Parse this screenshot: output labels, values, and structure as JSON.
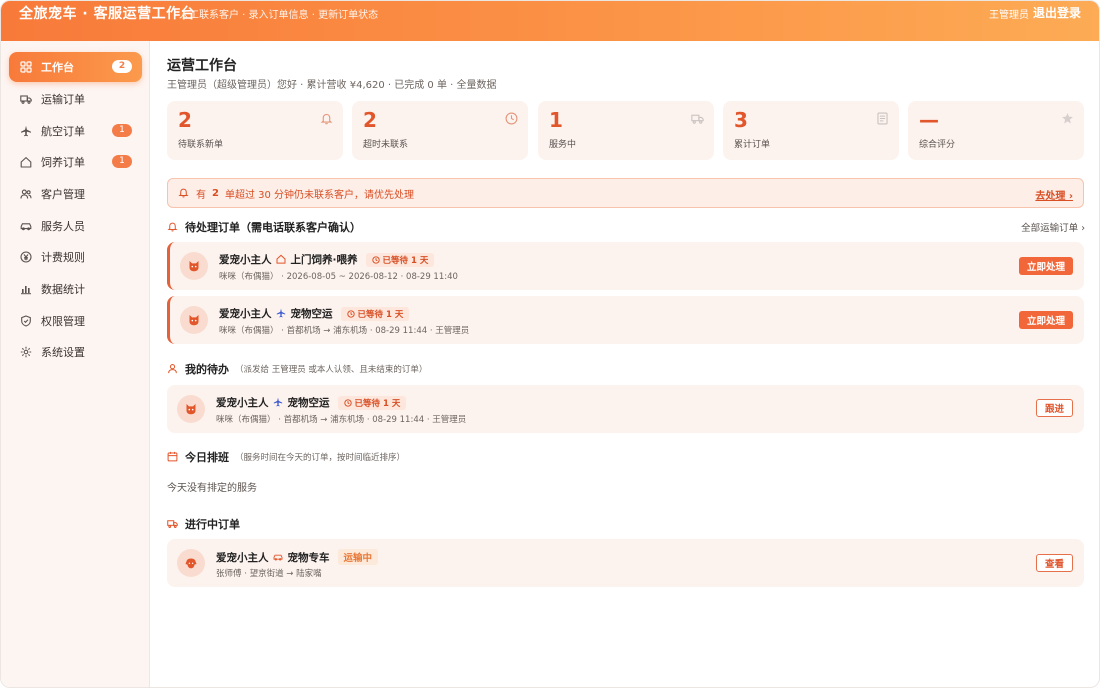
{
  "header": {
    "brand": "全旅宠车 · 客服运营工作台",
    "subtitle": "人工联系客户 · 录入订单信息 · 更新订单状态",
    "user": "王管理员",
    "logout": "退出登录"
  },
  "sidebar": {
    "items": [
      {
        "label": "工作台",
        "icon": "grid-icon",
        "badge": "2"
      },
      {
        "label": "运输订单",
        "icon": "truck-icon",
        "badge": ""
      },
      {
        "label": "航空订单",
        "icon": "plane-icon",
        "badge": "1"
      },
      {
        "label": "饲养订单",
        "icon": "home-icon",
        "badge": "1"
      },
      {
        "label": "客户管理",
        "icon": "users-icon",
        "badge": ""
      },
      {
        "label": "服务人员",
        "icon": "car-icon",
        "badge": ""
      },
      {
        "label": "计费规则",
        "icon": "yen-icon",
        "badge": ""
      },
      {
        "label": "数据统计",
        "icon": "bar-chart-icon",
        "badge": ""
      },
      {
        "label": "权限管理",
        "icon": "shield-icon",
        "badge": ""
      },
      {
        "label": "系统设置",
        "icon": "gear-icon",
        "badge": ""
      }
    ]
  },
  "main": {
    "title": "运营工作台",
    "subtitle": "王管理员（超级管理员）您好 · 累计营收 ¥4,620 · 已完成 0 单 · 全量数据",
    "stats": [
      {
        "value": "2",
        "label": "待联系新单",
        "icon": "bell-icon"
      },
      {
        "value": "2",
        "label": "超时未联系",
        "icon": "clock-icon"
      },
      {
        "value": "1",
        "label": "服务中",
        "icon": "truck-icon"
      },
      {
        "value": "3",
        "label": "累计订单",
        "icon": "document-icon"
      },
      {
        "value": "—",
        "label": "综合评分",
        "icon": "star-icon"
      }
    ],
    "alert": {
      "prefix": "有",
      "count": "2",
      "text": "单超过 30 分钟仍未联系客户，请优先处理",
      "link": "去处理 ›"
    },
    "pending": {
      "title": "待处理订单（需电话联系客户确认）",
      "link": "全部运输订单 ›",
      "orders": [
        {
          "customer": "爱宠小主人",
          "type_icon": "home-icon",
          "service": "上门饲养·喂养",
          "wait": "已等待 1 天",
          "detail": "咪咪（布偶猫） · 2026-08-05 ~ 2026-08-12 · 08-29 11:40",
          "action": "立即处理"
        },
        {
          "customer": "爱宠小主人",
          "type_icon": "plane-icon",
          "service": "宠物空运",
          "wait": "已等待 1 天",
          "detail": "咪咪（布偶猫） · 首都机场 → 浦东机场 · 08-29 11:44 · 王管理员",
          "action": "立即处理"
        }
      ]
    },
    "my_todo": {
      "title": "我的待办",
      "note": "（派发给 王管理员 或本人认领、且未结束的订单）",
      "orders": [
        {
          "customer": "爱宠小主人",
          "type_icon": "plane-icon",
          "service": "宠物空运",
          "wait": "已等待 1 天",
          "detail": "咪咪（布偶猫） · 首都机场 → 浦东机场 · 08-29 11:44 · 王管理员",
          "action": "跟进"
        }
      ]
    },
    "today": {
      "title": "今日排班",
      "note": "（服务时间在今天的订单，按时间临近排序）",
      "empty": "今天没有排定的服务"
    },
    "in_progress": {
      "title": "进行中订单",
      "orders": [
        {
          "customer": "爱宠小主人",
          "type_icon": "car-icon",
          "service": "宠物专车",
          "status": "运输中",
          "detail": "张师傅 · 望京街道 → 陆家嘴",
          "action": "查看"
        }
      ]
    }
  },
  "colors": {
    "accent": "#f2673a",
    "accent_light": "#fcf2ee",
    "alert_bg": "#fdeee8"
  }
}
